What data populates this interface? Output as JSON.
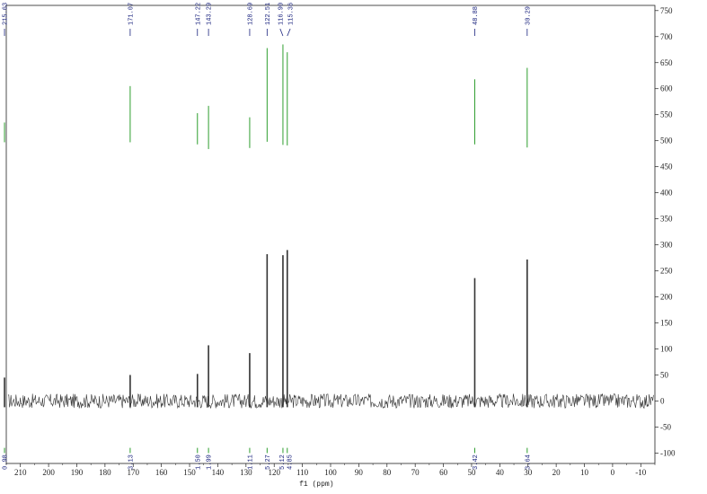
{
  "chart_data": {
    "type": "line",
    "title": "",
    "xlabel": "f1 (ppm)",
    "ylabel": "",
    "xlim": [
      215,
      -15
    ],
    "ylim": [
      -120,
      760
    ],
    "x_ticks": [
      210,
      200,
      190,
      180,
      170,
      160,
      150,
      140,
      130,
      120,
      110,
      100,
      90,
      80,
      70,
      60,
      50,
      40,
      30,
      20,
      10,
      0,
      -10
    ],
    "y_ticks": [
      -100,
      -50,
      0,
      50,
      100,
      150,
      200,
      250,
      300,
      350,
      400,
      450,
      500,
      550,
      600,
      650,
      700,
      750
    ],
    "peaks": [
      {
        "ppm": 215.63,
        "height": 45
      },
      {
        "ppm": 171.07,
        "height": 50
      },
      {
        "ppm": 147.22,
        "height": 52
      },
      {
        "ppm": 143.29,
        "height": 107
      },
      {
        "ppm": 128.69,
        "height": 92
      },
      {
        "ppm": 122.51,
        "height": 282
      },
      {
        "ppm": 116.9,
        "height": 280
      },
      {
        "ppm": 115.36,
        "height": 290
      },
      {
        "ppm": 48.88,
        "height": 236
      },
      {
        "ppm": 30.29,
        "height": 272
      }
    ],
    "peak_labels": [
      "215.63",
      "171.07",
      "147.22",
      "143.29",
      "128.69",
      "122.51",
      "116.90",
      "115.36",
      "48.88",
      "30.29"
    ],
    "integrals": [
      {
        "ppm": 215.63,
        "value": "0.98"
      },
      {
        "ppm": 171.07,
        "value": "3.13"
      },
      {
        "ppm": 147.22,
        "value": "1.50"
      },
      {
        "ppm": 143.29,
        "value": "1.99"
      },
      {
        "ppm": 128.69,
        "value": "1.11"
      },
      {
        "ppm": 122.51,
        "value": "5.27"
      },
      {
        "ppm": 116.9,
        "value": "5.12"
      },
      {
        "ppm": 115.36,
        "value": "4.85"
      },
      {
        "ppm": 48.88,
        "value": "3.42"
      },
      {
        "ppm": 30.29,
        "value": "3.64"
      }
    ],
    "noise_amplitude": 14,
    "colors": {
      "spectrum": "#333333",
      "integral": "#2e9e2e",
      "label": "#1a237e",
      "axis": "#222222"
    }
  }
}
